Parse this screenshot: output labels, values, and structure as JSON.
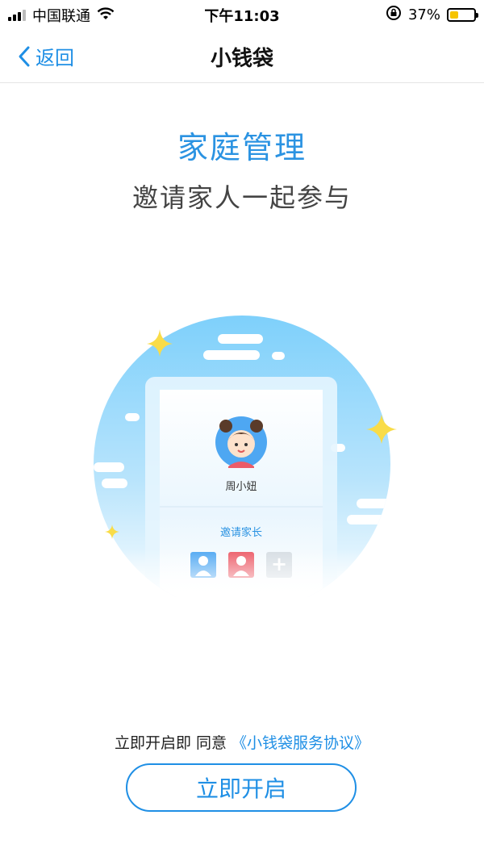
{
  "status_bar": {
    "carrier": "中国联通",
    "time": "下午11:03",
    "battery_percent": "37%",
    "battery_level": 0.37,
    "battery_color": "#f6c400",
    "icons": [
      "signal-icon",
      "wifi-icon",
      "orientation-lock-icon",
      "battery-icon"
    ]
  },
  "nav": {
    "back_label": "返回",
    "title": "小钱袋"
  },
  "main": {
    "heading": "家庭管理",
    "subheading": "邀请家人一起参与"
  },
  "illustration": {
    "card_name": "周小妞",
    "invite_label": "邀请家长",
    "add_symbol": "+"
  },
  "footer": {
    "agree_prefix": "立即开启即 同意 ",
    "agreement_link": "《小钱袋服务协议》",
    "start_button": "立即开启"
  },
  "colors": {
    "accent": "#1f8fe5",
    "heading": "#2b93e2",
    "sparkle": "#f9dc48"
  }
}
